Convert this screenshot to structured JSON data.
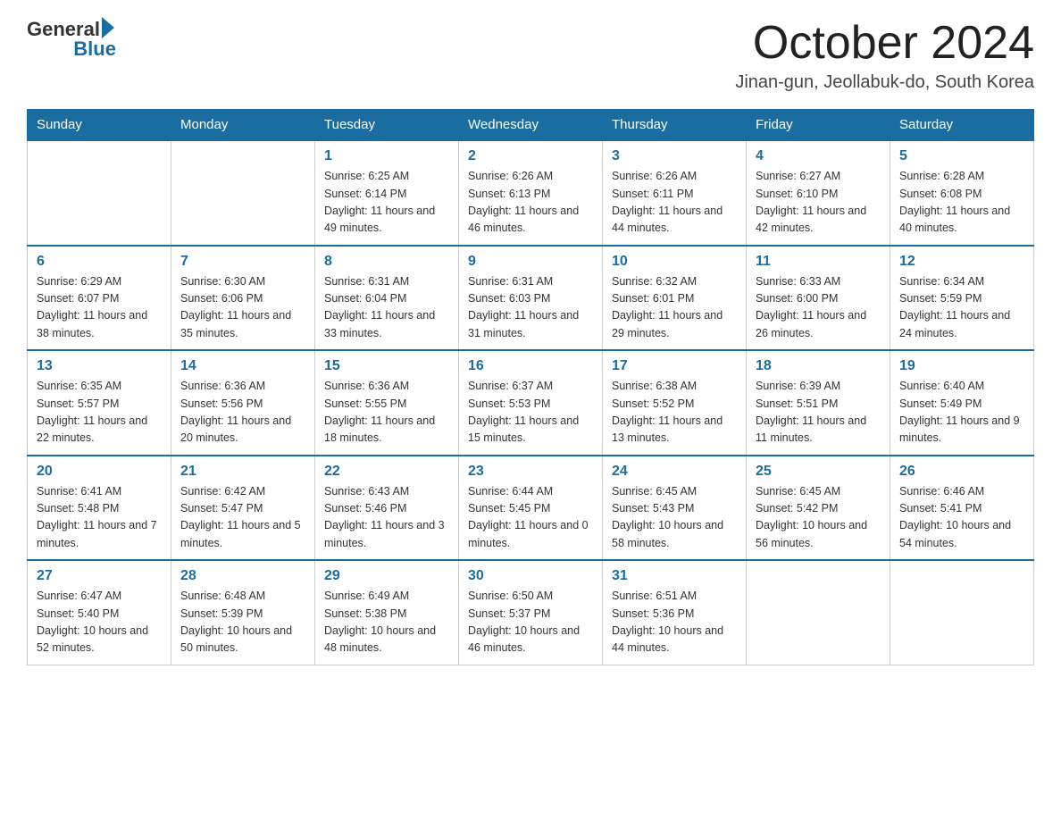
{
  "header": {
    "logo_general": "General",
    "logo_blue": "Blue",
    "month_title": "October 2024",
    "location": "Jinan-gun, Jeollabuk-do, South Korea"
  },
  "weekdays": [
    "Sunday",
    "Monday",
    "Tuesday",
    "Wednesday",
    "Thursday",
    "Friday",
    "Saturday"
  ],
  "weeks": [
    [
      {
        "day": "",
        "sunrise": "",
        "sunset": "",
        "daylight": ""
      },
      {
        "day": "",
        "sunrise": "",
        "sunset": "",
        "daylight": ""
      },
      {
        "day": "1",
        "sunrise": "Sunrise: 6:25 AM",
        "sunset": "Sunset: 6:14 PM",
        "daylight": "Daylight: 11 hours and 49 minutes."
      },
      {
        "day": "2",
        "sunrise": "Sunrise: 6:26 AM",
        "sunset": "Sunset: 6:13 PM",
        "daylight": "Daylight: 11 hours and 46 minutes."
      },
      {
        "day": "3",
        "sunrise": "Sunrise: 6:26 AM",
        "sunset": "Sunset: 6:11 PM",
        "daylight": "Daylight: 11 hours and 44 minutes."
      },
      {
        "day": "4",
        "sunrise": "Sunrise: 6:27 AM",
        "sunset": "Sunset: 6:10 PM",
        "daylight": "Daylight: 11 hours and 42 minutes."
      },
      {
        "day": "5",
        "sunrise": "Sunrise: 6:28 AM",
        "sunset": "Sunset: 6:08 PM",
        "daylight": "Daylight: 11 hours and 40 minutes."
      }
    ],
    [
      {
        "day": "6",
        "sunrise": "Sunrise: 6:29 AM",
        "sunset": "Sunset: 6:07 PM",
        "daylight": "Daylight: 11 hours and 38 minutes."
      },
      {
        "day": "7",
        "sunrise": "Sunrise: 6:30 AM",
        "sunset": "Sunset: 6:06 PM",
        "daylight": "Daylight: 11 hours and 35 minutes."
      },
      {
        "day": "8",
        "sunrise": "Sunrise: 6:31 AM",
        "sunset": "Sunset: 6:04 PM",
        "daylight": "Daylight: 11 hours and 33 minutes."
      },
      {
        "day": "9",
        "sunrise": "Sunrise: 6:31 AM",
        "sunset": "Sunset: 6:03 PM",
        "daylight": "Daylight: 11 hours and 31 minutes."
      },
      {
        "day": "10",
        "sunrise": "Sunrise: 6:32 AM",
        "sunset": "Sunset: 6:01 PM",
        "daylight": "Daylight: 11 hours and 29 minutes."
      },
      {
        "day": "11",
        "sunrise": "Sunrise: 6:33 AM",
        "sunset": "Sunset: 6:00 PM",
        "daylight": "Daylight: 11 hours and 26 minutes."
      },
      {
        "day": "12",
        "sunrise": "Sunrise: 6:34 AM",
        "sunset": "Sunset: 5:59 PM",
        "daylight": "Daylight: 11 hours and 24 minutes."
      }
    ],
    [
      {
        "day": "13",
        "sunrise": "Sunrise: 6:35 AM",
        "sunset": "Sunset: 5:57 PM",
        "daylight": "Daylight: 11 hours and 22 minutes."
      },
      {
        "day": "14",
        "sunrise": "Sunrise: 6:36 AM",
        "sunset": "Sunset: 5:56 PM",
        "daylight": "Daylight: 11 hours and 20 minutes."
      },
      {
        "day": "15",
        "sunrise": "Sunrise: 6:36 AM",
        "sunset": "Sunset: 5:55 PM",
        "daylight": "Daylight: 11 hours and 18 minutes."
      },
      {
        "day": "16",
        "sunrise": "Sunrise: 6:37 AM",
        "sunset": "Sunset: 5:53 PM",
        "daylight": "Daylight: 11 hours and 15 minutes."
      },
      {
        "day": "17",
        "sunrise": "Sunrise: 6:38 AM",
        "sunset": "Sunset: 5:52 PM",
        "daylight": "Daylight: 11 hours and 13 minutes."
      },
      {
        "day": "18",
        "sunrise": "Sunrise: 6:39 AM",
        "sunset": "Sunset: 5:51 PM",
        "daylight": "Daylight: 11 hours and 11 minutes."
      },
      {
        "day": "19",
        "sunrise": "Sunrise: 6:40 AM",
        "sunset": "Sunset: 5:49 PM",
        "daylight": "Daylight: 11 hours and 9 minutes."
      }
    ],
    [
      {
        "day": "20",
        "sunrise": "Sunrise: 6:41 AM",
        "sunset": "Sunset: 5:48 PM",
        "daylight": "Daylight: 11 hours and 7 minutes."
      },
      {
        "day": "21",
        "sunrise": "Sunrise: 6:42 AM",
        "sunset": "Sunset: 5:47 PM",
        "daylight": "Daylight: 11 hours and 5 minutes."
      },
      {
        "day": "22",
        "sunrise": "Sunrise: 6:43 AM",
        "sunset": "Sunset: 5:46 PM",
        "daylight": "Daylight: 11 hours and 3 minutes."
      },
      {
        "day": "23",
        "sunrise": "Sunrise: 6:44 AM",
        "sunset": "Sunset: 5:45 PM",
        "daylight": "Daylight: 11 hours and 0 minutes."
      },
      {
        "day": "24",
        "sunrise": "Sunrise: 6:45 AM",
        "sunset": "Sunset: 5:43 PM",
        "daylight": "Daylight: 10 hours and 58 minutes."
      },
      {
        "day": "25",
        "sunrise": "Sunrise: 6:45 AM",
        "sunset": "Sunset: 5:42 PM",
        "daylight": "Daylight: 10 hours and 56 minutes."
      },
      {
        "day": "26",
        "sunrise": "Sunrise: 6:46 AM",
        "sunset": "Sunset: 5:41 PM",
        "daylight": "Daylight: 10 hours and 54 minutes."
      }
    ],
    [
      {
        "day": "27",
        "sunrise": "Sunrise: 6:47 AM",
        "sunset": "Sunset: 5:40 PM",
        "daylight": "Daylight: 10 hours and 52 minutes."
      },
      {
        "day": "28",
        "sunrise": "Sunrise: 6:48 AM",
        "sunset": "Sunset: 5:39 PM",
        "daylight": "Daylight: 10 hours and 50 minutes."
      },
      {
        "day": "29",
        "sunrise": "Sunrise: 6:49 AM",
        "sunset": "Sunset: 5:38 PM",
        "daylight": "Daylight: 10 hours and 48 minutes."
      },
      {
        "day": "30",
        "sunrise": "Sunrise: 6:50 AM",
        "sunset": "Sunset: 5:37 PM",
        "daylight": "Daylight: 10 hours and 46 minutes."
      },
      {
        "day": "31",
        "sunrise": "Sunrise: 6:51 AM",
        "sunset": "Sunset: 5:36 PM",
        "daylight": "Daylight: 10 hours and 44 minutes."
      },
      {
        "day": "",
        "sunrise": "",
        "sunset": "",
        "daylight": ""
      },
      {
        "day": "",
        "sunrise": "",
        "sunset": "",
        "daylight": ""
      }
    ]
  ]
}
